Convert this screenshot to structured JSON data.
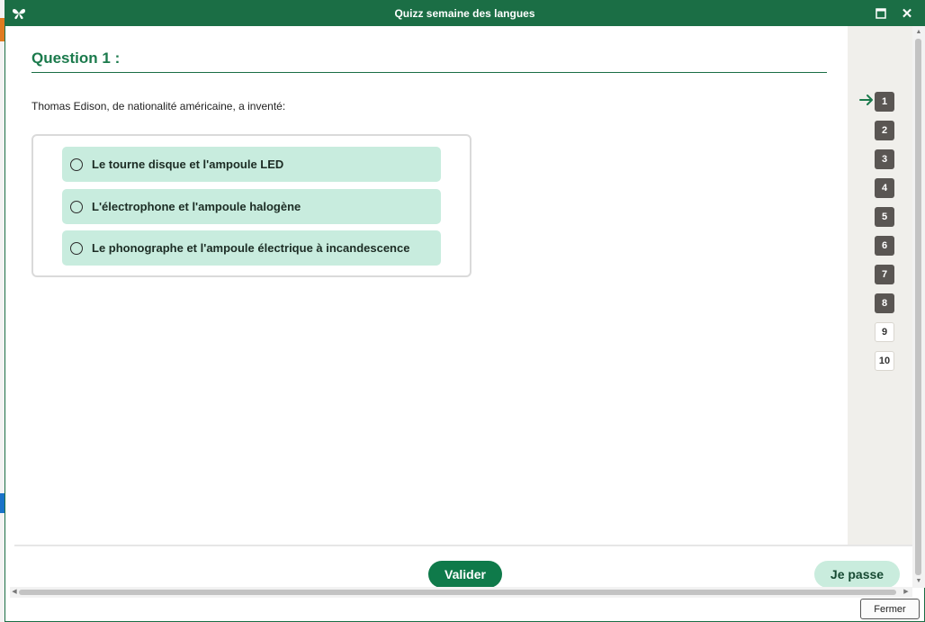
{
  "window": {
    "title": "Quizz semaine des langues",
    "brand_color": "#1b6e45"
  },
  "question": {
    "heading": "Question 1 :",
    "text": "Thomas Edison, de nationalité américaine, a inventé:"
  },
  "answers": [
    {
      "label": "Le tourne disque et l'ampoule LED",
      "selected": false
    },
    {
      "label": "L'électrophone et l'ampoule halogène",
      "selected": false
    },
    {
      "label": "Le phonographe et l'ampoule électrique à incandescence",
      "selected": false
    }
  ],
  "navigation": {
    "current": "1",
    "items": [
      {
        "label": "1",
        "state": "done"
      },
      {
        "label": "2",
        "state": "done"
      },
      {
        "label": "3",
        "state": "done"
      },
      {
        "label": "4",
        "state": "done"
      },
      {
        "label": "5",
        "state": "done"
      },
      {
        "label": "6",
        "state": "done"
      },
      {
        "label": "7",
        "state": "done"
      },
      {
        "label": "8",
        "state": "done"
      },
      {
        "label": "9",
        "state": "todo"
      },
      {
        "label": "10",
        "state": "todo"
      }
    ]
  },
  "buttons": {
    "validate": "Valider",
    "skip": "Je passe",
    "close": "Fermer"
  },
  "icons": {
    "logo": "butterfly-icon",
    "maximize": "maximize-icon",
    "close": "close-icon",
    "current_arrow": "arrow-right-icon"
  }
}
